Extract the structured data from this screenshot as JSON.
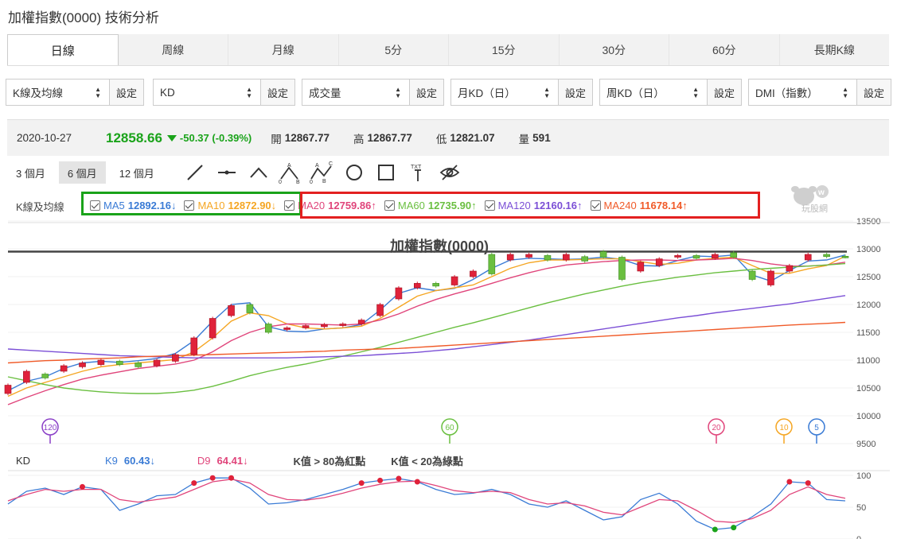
{
  "title": "加權指數(0000) 技術分析",
  "tabs": [
    "日線",
    "周線",
    "月線",
    "5分",
    "15分",
    "30分",
    "60分",
    "長期K線"
  ],
  "selectors": [
    {
      "value": "K線及均線",
      "button": "設定"
    },
    {
      "value": "KD",
      "button": "設定"
    },
    {
      "value": "成交量",
      "button": "設定"
    },
    {
      "value": "月KD（日）",
      "button": "設定"
    },
    {
      "value": "周KD（日）",
      "button": "設定"
    },
    {
      "value": "DMI（指數）",
      "button": "設定"
    }
  ],
  "quote": {
    "date": "2020-10-27",
    "price": "12858.66",
    "change": "-50.37 (-0.39%)",
    "open_label": "開",
    "open": "12867.77",
    "high_label": "高",
    "high": "12867.77",
    "low_label": "低",
    "low": "12821.07",
    "vol_label": "量",
    "vol": "591"
  },
  "ranges": [
    "3 個月",
    "6 個月",
    "12 個月"
  ],
  "tools": [
    "line-tool-icon",
    "horizontal-line-tool-icon",
    "angle-tool-icon",
    "abc-pattern-tool-icon",
    "abcd-pattern-tool-icon",
    "circle-tool-icon",
    "rectangle-tool-icon",
    "text-tool-icon",
    "hide-drawings-icon"
  ],
  "tool_text": {
    "txt": "TXT"
  },
  "ma_section_label": "K線及均線",
  "ma_legend": [
    {
      "name": "MA5",
      "value": "12892.16↓",
      "color": "#3a7bd5"
    },
    {
      "name": "MA10",
      "value": "12872.90↓",
      "color": "#f5a623"
    },
    {
      "name": "MA20",
      "value": "12759.86↑",
      "color": "#e0457b"
    },
    {
      "name": "MA60",
      "value": "12735.90↑",
      "color": "#6abf40"
    },
    {
      "name": "MA120",
      "value": "12160.16↑",
      "color": "#7b4fd6"
    },
    {
      "name": "MA240",
      "value": "11678.14↑",
      "color": "#f05a28"
    }
  ],
  "logo_text": "玩股網",
  "chart_title": "加權指數(0000)",
  "y_axis": [
    "13500",
    "13000",
    "12500",
    "12000",
    "11500",
    "11000",
    "10500",
    "10000",
    "9500"
  ],
  "ma_markers": [
    "120",
    "60",
    "20",
    "10",
    "5"
  ],
  "kd": {
    "label": "KD",
    "k_label": "K9",
    "k_value": "60.43↓",
    "d_label": "D9",
    "d_value": "64.41↓",
    "rule_red": "K值 > 80為紅點",
    "rule_green": "K值 < 20為綠點",
    "y_axis": [
      "100",
      "50",
      "0"
    ]
  },
  "chart_data": {
    "type": "line",
    "title": "加權指數(0000)",
    "ylim": [
      9500,
      13500
    ],
    "resistance_level": 12950,
    "series": [
      {
        "name": "MA5",
        "color": "#3a7bd5",
        "values": [
          10450,
          10620,
          10700,
          10850,
          10950,
          10980,
          10960,
          10990,
          11030,
          11120,
          11350,
          11700,
          12000,
          12030,
          11600,
          11520,
          11510,
          11560,
          11580,
          11640,
          11900,
          12200,
          12300,
          12250,
          12290,
          12450,
          12650,
          12800,
          12830,
          12820,
          12810,
          12820,
          12850,
          12810,
          12700,
          12690,
          12790,
          12870,
          12860,
          12890,
          12530,
          12420,
          12610,
          12780,
          12800,
          12890
        ]
      },
      {
        "name": "MA10",
        "color": "#f5a623",
        "values": [
          10350,
          10500,
          10600,
          10700,
          10800,
          10880,
          10920,
          10950,
          10980,
          11010,
          11150,
          11400,
          11700,
          11850,
          11800,
          11650,
          11580,
          11560,
          11580,
          11610,
          11750,
          11950,
          12150,
          12250,
          12300,
          12350,
          12500,
          12650,
          12750,
          12800,
          12800,
          12810,
          12820,
          12820,
          12770,
          12720,
          12740,
          12800,
          12830,
          12850,
          12700,
          12560,
          12560,
          12640,
          12700,
          12870
        ]
      },
      {
        "name": "MA20",
        "color": "#e0457b",
        "values": [
          10200,
          10330,
          10450,
          10560,
          10660,
          10730,
          10790,
          10850,
          10890,
          10930,
          11000,
          11150,
          11350,
          11500,
          11600,
          11650,
          11650,
          11640,
          11630,
          11650,
          11720,
          11830,
          11970,
          12090,
          12190,
          12280,
          12380,
          12480,
          12570,
          12650,
          12710,
          12740,
          12770,
          12790,
          12800,
          12800,
          12790,
          12800,
          12810,
          12830,
          12790,
          12730,
          12690,
          12690,
          12710,
          12760
        ]
      },
      {
        "name": "MA60",
        "color": "#6abf40",
        "values": [
          10700,
          10630,
          10560,
          10500,
          10460,
          10430,
          10410,
          10400,
          10400,
          10420,
          10460,
          10530,
          10620,
          10720,
          10800,
          10870,
          10930,
          11000,
          11070,
          11150,
          11230,
          11320,
          11410,
          11500,
          11590,
          11670,
          11760,
          11850,
          11940,
          12030,
          12110,
          12190,
          12260,
          12330,
          12390,
          12440,
          12490,
          12530,
          12570,
          12600,
          12630,
          12650,
          12670,
          12690,
          12710,
          12735
        ]
      },
      {
        "name": "MA120",
        "color": "#7b4fd6",
        "values": [
          11200,
          11180,
          11160,
          11140,
          11120,
          11100,
          11080,
          11070,
          11060,
          11050,
          11040,
          11040,
          11040,
          11040,
          11040,
          11040,
          11050,
          11060,
          11070,
          11080,
          11100,
          11120,
          11140,
          11170,
          11200,
          11240,
          11280,
          11320,
          11360,
          11410,
          11460,
          11510,
          11560,
          11610,
          11660,
          11710,
          11760,
          11800,
          11850,
          11890,
          11930,
          11970,
          12010,
          12060,
          12110,
          12160
        ]
      },
      {
        "name": "MA240",
        "color": "#f05a28",
        "values": [
          10950,
          10970,
          10990,
          11000,
          11020,
          11030,
          11040,
          11060,
          11070,
          11080,
          11090,
          11100,
          11110,
          11120,
          11130,
          11140,
          11150,
          11160,
          11180,
          11190,
          11200,
          11210,
          11230,
          11250,
          11270,
          11290,
          11310,
          11330,
          11350,
          11370,
          11390,
          11410,
          11430,
          11450,
          11470,
          11490,
          11510,
          11530,
          11550,
          11570,
          11590,
          11610,
          11630,
          11645,
          11660,
          11678
        ]
      }
    ],
    "candles": [
      {
        "o": 10400,
        "c": 10550
      },
      {
        "o": 10600,
        "c": 10800
      },
      {
        "o": 10750,
        "c": 10680
      },
      {
        "o": 10800,
        "c": 10900
      },
      {
        "o": 10880,
        "c": 10950
      },
      {
        "o": 10920,
        "c": 11000
      },
      {
        "o": 10980,
        "c": 10920
      },
      {
        "o": 10950,
        "c": 10880
      },
      {
        "o": 10900,
        "c": 11000
      },
      {
        "o": 10980,
        "c": 11100
      },
      {
        "o": 11100,
        "c": 11400
      },
      {
        "o": 11400,
        "c": 11750
      },
      {
        "o": 11800,
        "c": 11980
      },
      {
        "o": 12000,
        "c": 11850
      },
      {
        "o": 11650,
        "c": 11500
      },
      {
        "o": 11550,
        "c": 11580
      },
      {
        "o": 11580,
        "c": 11620
      },
      {
        "o": 11600,
        "c": 11640
      },
      {
        "o": 11620,
        "c": 11650
      },
      {
        "o": 11650,
        "c": 11720
      },
      {
        "o": 11800,
        "c": 12000
      },
      {
        "o": 12100,
        "c": 12300
      },
      {
        "o": 12300,
        "c": 12380
      },
      {
        "o": 12380,
        "c": 12330
      },
      {
        "o": 12350,
        "c": 12500
      },
      {
        "o": 12500,
        "c": 12600
      },
      {
        "o": 12900,
        "c": 12550
      },
      {
        "o": 12800,
        "c": 12900
      },
      {
        "o": 12850,
        "c": 12900
      },
      {
        "o": 12880,
        "c": 12800
      },
      {
        "o": 12800,
        "c": 12900
      },
      {
        "o": 12860,
        "c": 12780
      },
      {
        "o": 12950,
        "c": 12850
      },
      {
        "o": 12850,
        "c": 12450
      },
      {
        "o": 12600,
        "c": 12760
      },
      {
        "o": 12700,
        "c": 12820
      },
      {
        "o": 12850,
        "c": 12880
      },
      {
        "o": 12880,
        "c": 12830
      },
      {
        "o": 12830,
        "c": 12900
      },
      {
        "o": 12930,
        "c": 12850
      },
      {
        "o": 12600,
        "c": 12450
      },
      {
        "o": 12350,
        "c": 12600
      },
      {
        "o": 12600,
        "c": 12700
      },
      {
        "o": 12800,
        "c": 12900
      },
      {
        "o": 12900,
        "c": 12860
      },
      {
        "o": 12867,
        "c": 12858
      }
    ],
    "kd_series": [
      {
        "name": "K9",
        "color": "#3a7bd5",
        "values": [
          55,
          75,
          80,
          70,
          82,
          78,
          45,
          55,
          68,
          70,
          88,
          96,
          96,
          80,
          55,
          57,
          62,
          70,
          78,
          88,
          92,
          95,
          90,
          78,
          70,
          72,
          78,
          70,
          55,
          50,
          60,
          45,
          30,
          35,
          62,
          72,
          55,
          28,
          15,
          18,
          35,
          55,
          90,
          88,
          62,
          60
        ]
      },
      {
        "name": "D9",
        "color": "#e0457b",
        "values": [
          60,
          70,
          78,
          75,
          78,
          78,
          62,
          58,
          62,
          66,
          78,
          90,
          94,
          88,
          70,
          62,
          61,
          65,
          72,
          80,
          86,
          90,
          91,
          84,
          76,
          73,
          75,
          73,
          62,
          55,
          57,
          52,
          42,
          38,
          50,
          62,
          60,
          45,
          28,
          26,
          32,
          45,
          70,
          82,
          70,
          64
        ]
      }
    ]
  }
}
